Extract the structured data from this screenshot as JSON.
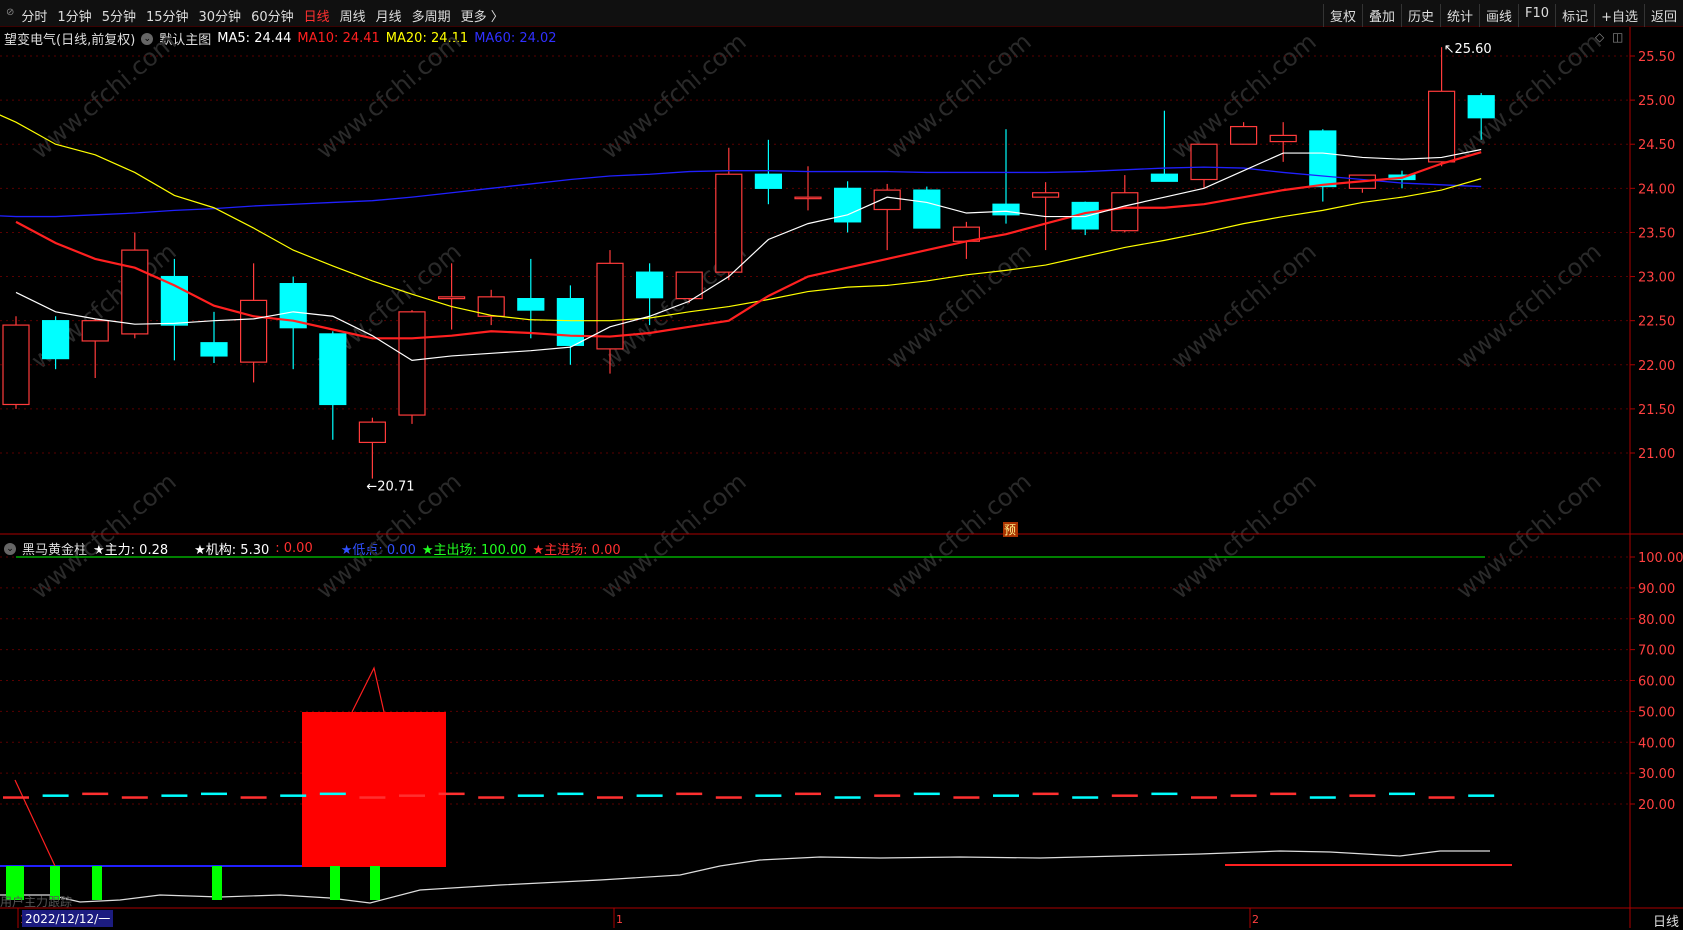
{
  "toolbar": {
    "periods": [
      "分时",
      "1分钟",
      "5分钟",
      "15分钟",
      "30分钟",
      "60分钟",
      "日线",
      "周线",
      "月线",
      "多周期",
      "更多 〉"
    ],
    "active_period": "日线",
    "actions": [
      "复权",
      "叠加",
      "历史",
      "统计",
      "画线",
      "F10",
      "标记",
      "+自选",
      "返回"
    ]
  },
  "main_panel": {
    "stock_title": "望变电气(日线,前复权)",
    "template": "默认主图",
    "ma5": "MA5: 24.44",
    "ma10": "MA10: 24.41",
    "ma20": "MA20: 24.11",
    "ma60": "MA60: 24.02",
    "high_marker": "25.60",
    "low_marker": "20.71",
    "forecast_badge": "预",
    "price_axis": [
      "25.50",
      "25.00",
      "24.50",
      "24.00",
      "23.50",
      "23.00",
      "22.50",
      "22.00",
      "21.50",
      "21.00"
    ]
  },
  "sub_panel": {
    "indicator_name": "黑马黄金柱",
    "zhuli": "★主力: 0.28",
    "jigou": "★机构: 5.30",
    "jigou_extra": ": 0.00",
    "didian": "★低点: 0.00",
    "zhuchuchang": "★主出场: 100.00",
    "zhujinchang": "★主进场: 0.00",
    "axis": [
      "100.00",
      "90.00",
      "80.00",
      "70.00",
      "60.00",
      "50.00",
      "40.00",
      "30.00",
      "20.00"
    ],
    "bottom_label": "用户主力跟踪"
  },
  "footer": {
    "date": "2022/12/12/一",
    "period_label": "日线",
    "month_ticks": [
      "1",
      "1",
      "2"
    ]
  },
  "watermark": "www.cfchi.com",
  "colors": {
    "up": "#ff3b3b",
    "down": "#00ffff",
    "ma5": "#ffffff",
    "ma10": "#ff2020",
    "ma20": "#ffff00",
    "ma60": "#2020ff",
    "accent": "#ff3030"
  },
  "chart_data": {
    "type": "candlestick",
    "price_range": [
      20.5,
      25.7
    ],
    "candles": [
      {
        "o": 21.55,
        "h": 22.55,
        "l": 21.5,
        "c": 22.45
      },
      {
        "o": 22.5,
        "h": 22.55,
        "l": 21.95,
        "c": 22.07
      },
      {
        "o": 22.27,
        "h": 22.52,
        "l": 21.85,
        "c": 22.5
      },
      {
        "o": 22.35,
        "h": 23.5,
        "l": 22.3,
        "c": 23.3
      },
      {
        "o": 23.0,
        "h": 23.2,
        "l": 22.05,
        "c": 22.45
      },
      {
        "o": 22.25,
        "h": 22.6,
        "l": 22.02,
        "c": 22.1
      },
      {
        "o": 22.03,
        "h": 23.15,
        "l": 21.8,
        "c": 22.73
      },
      {
        "o": 22.92,
        "h": 23.0,
        "l": 21.95,
        "c": 22.42
      },
      {
        "o": 22.35,
        "h": 22.38,
        "l": 21.15,
        "c": 21.55
      },
      {
        "o": 21.12,
        "h": 21.4,
        "l": 20.71,
        "c": 21.35
      },
      {
        "o": 21.43,
        "h": 22.62,
        "l": 21.33,
        "c": 22.6
      },
      {
        "o": 22.75,
        "h": 23.15,
        "l": 22.4,
        "c": 22.77
      },
      {
        "o": 22.55,
        "h": 22.85,
        "l": 22.45,
        "c": 22.77
      },
      {
        "o": 22.75,
        "h": 23.2,
        "l": 22.3,
        "c": 22.62
      },
      {
        "o": 22.75,
        "h": 22.9,
        "l": 22.0,
        "c": 22.22
      },
      {
        "o": 22.18,
        "h": 23.3,
        "l": 21.9,
        "c": 23.15
      },
      {
        "o": 23.05,
        "h": 23.15,
        "l": 22.45,
        "c": 22.76
      },
      {
        "o": 22.75,
        "h": 23.05,
        "l": 22.7,
        "c": 23.05
      },
      {
        "o": 23.05,
        "h": 24.46,
        "l": 22.96,
        "c": 24.16
      },
      {
        "o": 24.16,
        "h": 24.55,
        "l": 23.82,
        "c": 24.0
      },
      {
        "o": 23.9,
        "h": 24.25,
        "l": 23.75,
        "c": 23.9
      },
      {
        "o": 24.0,
        "h": 24.08,
        "l": 23.5,
        "c": 23.62
      },
      {
        "o": 23.76,
        "h": 24.05,
        "l": 23.3,
        "c": 23.98
      },
      {
        "o": 23.98,
        "h": 24.02,
        "l": 23.55,
        "c": 23.55
      },
      {
        "o": 23.4,
        "h": 23.62,
        "l": 23.2,
        "c": 23.56
      },
      {
        "o": 23.82,
        "h": 24.67,
        "l": 23.6,
        "c": 23.7
      },
      {
        "o": 23.9,
        "h": 24.07,
        "l": 23.3,
        "c": 23.95
      },
      {
        "o": 23.84,
        "h": 23.85,
        "l": 23.47,
        "c": 23.54
      },
      {
        "o": 23.52,
        "h": 24.15,
        "l": 23.5,
        "c": 23.95
      },
      {
        "o": 24.16,
        "h": 24.88,
        "l": 24.1,
        "c": 24.08
      },
      {
        "o": 24.1,
        "h": 24.5,
        "l": 24.0,
        "c": 24.5
      },
      {
        "o": 24.5,
        "h": 24.75,
        "l": 24.5,
        "c": 24.7
      },
      {
        "o": 24.53,
        "h": 24.75,
        "l": 24.3,
        "c": 24.6
      },
      {
        "o": 24.65,
        "h": 24.67,
        "l": 23.85,
        "c": 24.02
      },
      {
        "o": 24.0,
        "h": 24.15,
        "l": 23.95,
        "c": 24.15
      },
      {
        "o": 24.15,
        "h": 24.2,
        "l": 24.0,
        "c": 24.1
      },
      {
        "o": 24.3,
        "h": 25.6,
        "l": 24.25,
        "c": 25.1
      },
      {
        "o": 25.05,
        "h": 25.08,
        "l": 24.55,
        "c": 24.8
      }
    ],
    "ma5": [
      22.82,
      22.6,
      22.52,
      22.46,
      22.47,
      22.5,
      22.52,
      22.6,
      22.55,
      22.33,
      22.05,
      22.1,
      22.13,
      22.16,
      22.2,
      22.43,
      22.55,
      22.72,
      23.0,
      23.42,
      23.6,
      23.7,
      23.9,
      23.84,
      23.72,
      23.74,
      23.68,
      23.68,
      23.8,
      23.9,
      24.0,
      24.2,
      24.4,
      24.4,
      24.35,
      24.33,
      24.35,
      24.44
    ],
    "ma10": [
      23.62,
      23.38,
      23.2,
      23.1,
      22.9,
      22.67,
      22.55,
      22.5,
      22.4,
      22.3,
      22.3,
      22.33,
      22.38,
      22.36,
      22.33,
      22.32,
      22.36,
      22.43,
      22.5,
      22.78,
      23.0,
      23.1,
      23.2,
      23.3,
      23.4,
      23.48,
      23.6,
      23.72,
      23.78,
      23.78,
      23.82,
      23.9,
      23.98,
      24.04,
      24.08,
      24.12,
      24.28,
      24.41
    ],
    "ma20": [
      24.95,
      24.75,
      24.5,
      24.38,
      24.18,
      23.92,
      23.78,
      23.55,
      23.3,
      23.12,
      22.95,
      22.8,
      22.66,
      22.56,
      22.51,
      22.5,
      22.5,
      22.53,
      22.6,
      22.66,
      22.74,
      22.83,
      22.88,
      22.9,
      22.95,
      23.02,
      23.07,
      23.13,
      23.23,
      23.33,
      23.41,
      23.5,
      23.6,
      23.68,
      23.75,
      23.84,
      23.9,
      23.98,
      24.11
    ],
    "ma60": [
      23.7,
      23.68,
      23.68,
      23.7,
      23.72,
      23.75,
      23.77,
      23.8,
      23.82,
      23.84,
      23.86,
      23.9,
      23.95,
      24.0,
      24.05,
      24.1,
      24.14,
      24.16,
      24.19,
      24.2,
      24.2,
      24.19,
      24.19,
      24.19,
      24.18,
      24.18,
      24.18,
      24.18,
      24.19,
      24.21,
      24.23,
      24.24,
      24.23,
      24.18,
      24.14,
      24.1,
      24.06,
      24.04,
      24.02
    ]
  }
}
